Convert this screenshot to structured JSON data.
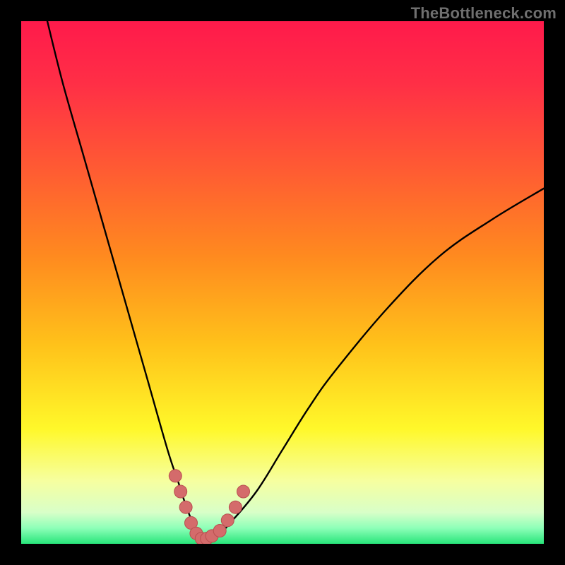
{
  "watermark": "TheBottleneck.com",
  "colors": {
    "frame": "#000000",
    "gradient_stops": [
      {
        "offset": 0.0,
        "color": "#ff1a4b"
      },
      {
        "offset": 0.12,
        "color": "#ff2f46"
      },
      {
        "offset": 0.28,
        "color": "#ff5a33"
      },
      {
        "offset": 0.45,
        "color": "#ff8a1f"
      },
      {
        "offset": 0.62,
        "color": "#ffc21a"
      },
      {
        "offset": 0.78,
        "color": "#fff82a"
      },
      {
        "offset": 0.88,
        "color": "#f6ffa0"
      },
      {
        "offset": 0.94,
        "color": "#d8ffc8"
      },
      {
        "offset": 0.97,
        "color": "#8dffb8"
      },
      {
        "offset": 1.0,
        "color": "#28e57a"
      }
    ],
    "curve": "#000000",
    "marker_fill": "#d46b6b",
    "marker_stroke": "#b94f4f"
  },
  "chart_data": {
    "type": "line",
    "title": "",
    "xlabel": "",
    "ylabel": "",
    "xlim": [
      0,
      100
    ],
    "ylim": [
      0,
      100
    ],
    "series": [
      {
        "name": "bottleneck-curve",
        "x": [
          5,
          8,
          12,
          16,
          20,
          24,
          28,
          30,
          32,
          34,
          36,
          38,
          40,
          45,
          50,
          55,
          60,
          70,
          80,
          90,
          100
        ],
        "y": [
          100,
          88,
          74,
          60,
          46,
          32,
          18,
          12,
          6,
          2,
          1,
          2,
          4,
          10,
          18,
          26,
          33,
          45,
          55,
          62,
          68
        ]
      }
    ],
    "markers": {
      "name": "highlight-points",
      "x": [
        29.5,
        30.5,
        31.5,
        32.5,
        33.5,
        34.5,
        35.5,
        36.5,
        38.0,
        39.5,
        41.0,
        42.5
      ],
      "y": [
        13,
        10,
        7,
        4,
        2,
        1,
        1,
        1.5,
        2.5,
        4.5,
        7,
        10
      ]
    }
  }
}
